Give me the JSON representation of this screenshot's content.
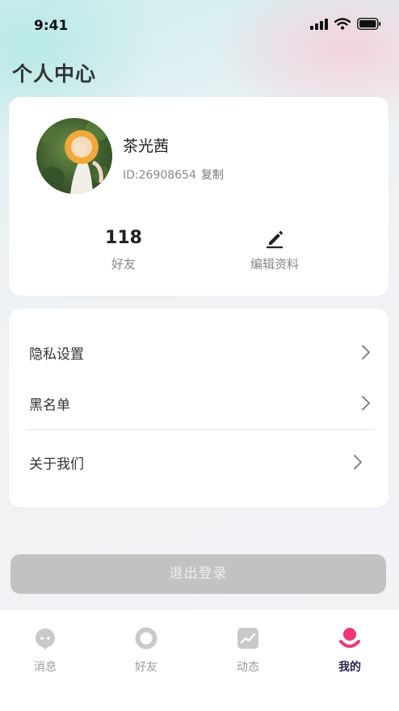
{
  "status_bar": {
    "time": "9:41"
  },
  "page": {
    "title": "个人中心"
  },
  "profile": {
    "name": "茶光茜",
    "id_text": "ID:26908654",
    "copy_label": "复制",
    "friends_count": "118",
    "friends_label": "好友",
    "edit_label": "编辑资料"
  },
  "menu": {
    "items": [
      {
        "label": "隐私设置"
      },
      {
        "label": "黑名单"
      },
      {
        "label": "关于我们"
      }
    ]
  },
  "logout": {
    "label": "退出登录"
  },
  "tabbar": {
    "tabs": [
      {
        "label": "消息",
        "icon": "chat-bubble-icon"
      },
      {
        "label": "好友",
        "icon": "ring-icon"
      },
      {
        "label": "动态",
        "icon": "trend-chart-icon"
      },
      {
        "label": "我的",
        "icon": "smile-profile-icon",
        "active": true
      }
    ]
  },
  "colors": {
    "active_tab_icon": "#f0357a",
    "active_tab_text": "#2b2350",
    "inactive": "#c9c9c9",
    "logout_bg": "#c2c2c2"
  }
}
